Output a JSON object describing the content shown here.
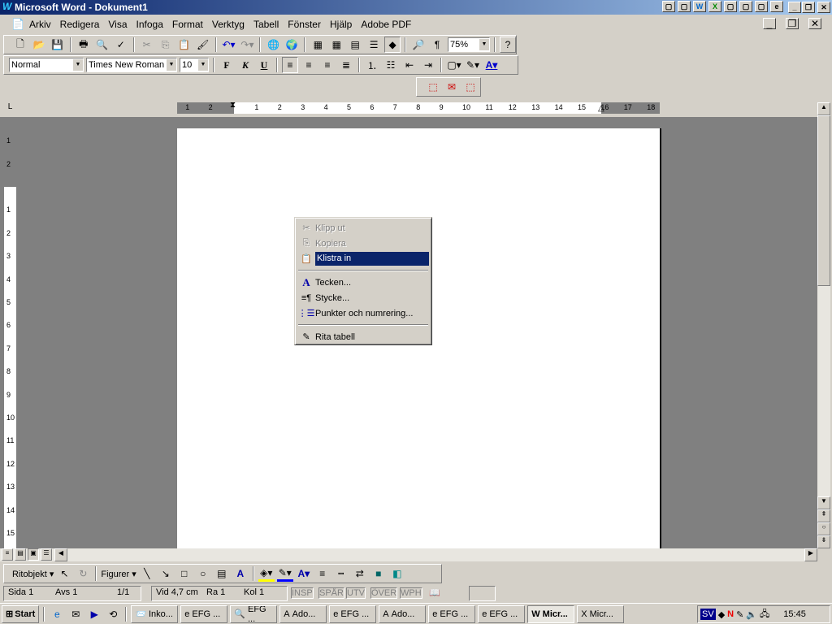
{
  "window": {
    "title": "Microsoft Word - Dokument1"
  },
  "menu": [
    "Arkiv",
    "Redigera",
    "Visa",
    "Infoga",
    "Format",
    "Verktyg",
    "Tabell",
    "Fönster",
    "Hjälp",
    "Adobe PDF"
  ],
  "standard_toolbar": {
    "zoom": "75%"
  },
  "format_toolbar": {
    "style": "Normal",
    "font": "Times New Roman",
    "size": "10",
    "bold": "F",
    "italic": "K",
    "underline": "U"
  },
  "ruler": {
    "h_left": [
      "2",
      "1"
    ],
    "h_right": [
      "1",
      "2",
      "3",
      "4",
      "5",
      "6",
      "7",
      "8",
      "9",
      "10",
      "11",
      "12",
      "13",
      "14",
      "15",
      "16",
      "17",
      "18"
    ],
    "v_top": [
      "2",
      "1"
    ],
    "v_main": [
      "1",
      "2",
      "3",
      "4",
      "5",
      "6",
      "7",
      "8",
      "9",
      "10",
      "11",
      "12",
      "13",
      "14",
      "15"
    ]
  },
  "context_menu": [
    {
      "label": "Klipp ut",
      "icon": "scissors-icon",
      "disabled": true
    },
    {
      "label": "Kopiera",
      "icon": "copy-icon",
      "disabled": true
    },
    {
      "label": "Klistra in",
      "icon": "paste-icon",
      "selected": true
    },
    {
      "label": "Tecken...",
      "icon": "font-a-icon"
    },
    {
      "label": "Stycke...",
      "icon": "paragraph-icon"
    },
    {
      "label": "Punkter och numrering...",
      "icon": "bullets-icon"
    },
    {
      "label": "Rita tabell",
      "icon": "pencil-icon"
    }
  ],
  "drawing_toolbar": {
    "draw": "Ritobjekt",
    "shapes": "Figurer"
  },
  "status": {
    "page": "Sida 1",
    "section": "Avs 1",
    "pages": "1/1",
    "at": "Vid 4,7 cm",
    "line": "Ra 1",
    "col": "Kol 1",
    "modes": [
      "INSP",
      "SPÅR",
      "UTV",
      "ÖVER",
      "WPH"
    ]
  },
  "taskbar": {
    "start": "Start",
    "tasks": [
      "Inko...",
      "EFG ...",
      "EFG ...",
      "Ado...",
      "EFG ...",
      "Ado...",
      "EFG ...",
      "EFG ...",
      "Micr...",
      "Micr..."
    ],
    "active": 8,
    "lang": "SV",
    "clock": "15:45"
  },
  "colors": {
    "title": "#0a246a",
    "selection": "#0a246a",
    "face": "#d4d0c8",
    "workspace": "#808080"
  }
}
